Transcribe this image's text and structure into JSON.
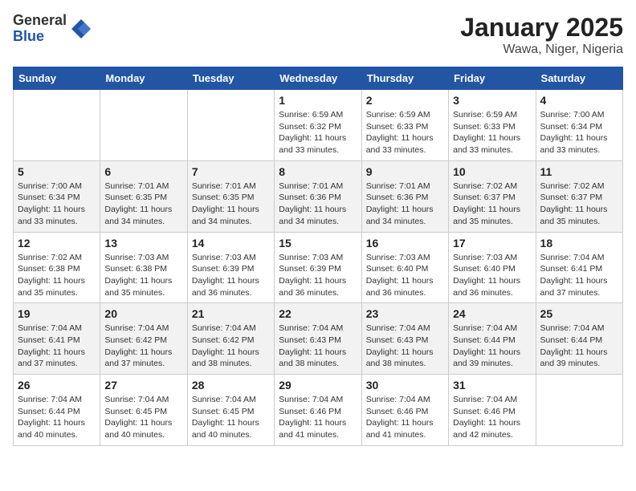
{
  "logo": {
    "general": "General",
    "blue": "Blue"
  },
  "header": {
    "month": "January 2025",
    "location": "Wawa, Niger, Nigeria"
  },
  "weekdays": [
    "Sunday",
    "Monday",
    "Tuesday",
    "Wednesday",
    "Thursday",
    "Friday",
    "Saturday"
  ],
  "weeks": [
    [
      {
        "day": "",
        "info": ""
      },
      {
        "day": "",
        "info": ""
      },
      {
        "day": "",
        "info": ""
      },
      {
        "day": "1",
        "info": "Sunrise: 6:59 AM\nSunset: 6:32 PM\nDaylight: 11 hours\nand 33 minutes."
      },
      {
        "day": "2",
        "info": "Sunrise: 6:59 AM\nSunset: 6:33 PM\nDaylight: 11 hours\nand 33 minutes."
      },
      {
        "day": "3",
        "info": "Sunrise: 6:59 AM\nSunset: 6:33 PM\nDaylight: 11 hours\nand 33 minutes."
      },
      {
        "day": "4",
        "info": "Sunrise: 7:00 AM\nSunset: 6:34 PM\nDaylight: 11 hours\nand 33 minutes."
      }
    ],
    [
      {
        "day": "5",
        "info": "Sunrise: 7:00 AM\nSunset: 6:34 PM\nDaylight: 11 hours\nand 33 minutes."
      },
      {
        "day": "6",
        "info": "Sunrise: 7:01 AM\nSunset: 6:35 PM\nDaylight: 11 hours\nand 34 minutes."
      },
      {
        "day": "7",
        "info": "Sunrise: 7:01 AM\nSunset: 6:35 PM\nDaylight: 11 hours\nand 34 minutes."
      },
      {
        "day": "8",
        "info": "Sunrise: 7:01 AM\nSunset: 6:36 PM\nDaylight: 11 hours\nand 34 minutes."
      },
      {
        "day": "9",
        "info": "Sunrise: 7:01 AM\nSunset: 6:36 PM\nDaylight: 11 hours\nand 34 minutes."
      },
      {
        "day": "10",
        "info": "Sunrise: 7:02 AM\nSunset: 6:37 PM\nDaylight: 11 hours\nand 35 minutes."
      },
      {
        "day": "11",
        "info": "Sunrise: 7:02 AM\nSunset: 6:37 PM\nDaylight: 11 hours\nand 35 minutes."
      }
    ],
    [
      {
        "day": "12",
        "info": "Sunrise: 7:02 AM\nSunset: 6:38 PM\nDaylight: 11 hours\nand 35 minutes."
      },
      {
        "day": "13",
        "info": "Sunrise: 7:03 AM\nSunset: 6:38 PM\nDaylight: 11 hours\nand 35 minutes."
      },
      {
        "day": "14",
        "info": "Sunrise: 7:03 AM\nSunset: 6:39 PM\nDaylight: 11 hours\nand 36 minutes."
      },
      {
        "day": "15",
        "info": "Sunrise: 7:03 AM\nSunset: 6:39 PM\nDaylight: 11 hours\nand 36 minutes."
      },
      {
        "day": "16",
        "info": "Sunrise: 7:03 AM\nSunset: 6:40 PM\nDaylight: 11 hours\nand 36 minutes."
      },
      {
        "day": "17",
        "info": "Sunrise: 7:03 AM\nSunset: 6:40 PM\nDaylight: 11 hours\nand 36 minutes."
      },
      {
        "day": "18",
        "info": "Sunrise: 7:04 AM\nSunset: 6:41 PM\nDaylight: 11 hours\nand 37 minutes."
      }
    ],
    [
      {
        "day": "19",
        "info": "Sunrise: 7:04 AM\nSunset: 6:41 PM\nDaylight: 11 hours\nand 37 minutes."
      },
      {
        "day": "20",
        "info": "Sunrise: 7:04 AM\nSunset: 6:42 PM\nDaylight: 11 hours\nand 37 minutes."
      },
      {
        "day": "21",
        "info": "Sunrise: 7:04 AM\nSunset: 6:42 PM\nDaylight: 11 hours\nand 38 minutes."
      },
      {
        "day": "22",
        "info": "Sunrise: 7:04 AM\nSunset: 6:43 PM\nDaylight: 11 hours\nand 38 minutes."
      },
      {
        "day": "23",
        "info": "Sunrise: 7:04 AM\nSunset: 6:43 PM\nDaylight: 11 hours\nand 38 minutes."
      },
      {
        "day": "24",
        "info": "Sunrise: 7:04 AM\nSunset: 6:44 PM\nDaylight: 11 hours\nand 39 minutes."
      },
      {
        "day": "25",
        "info": "Sunrise: 7:04 AM\nSunset: 6:44 PM\nDaylight: 11 hours\nand 39 minutes."
      }
    ],
    [
      {
        "day": "26",
        "info": "Sunrise: 7:04 AM\nSunset: 6:44 PM\nDaylight: 11 hours\nand 40 minutes."
      },
      {
        "day": "27",
        "info": "Sunrise: 7:04 AM\nSunset: 6:45 PM\nDaylight: 11 hours\nand 40 minutes."
      },
      {
        "day": "28",
        "info": "Sunrise: 7:04 AM\nSunset: 6:45 PM\nDaylight: 11 hours\nand 40 minutes."
      },
      {
        "day": "29",
        "info": "Sunrise: 7:04 AM\nSunset: 6:46 PM\nDaylight: 11 hours\nand 41 minutes."
      },
      {
        "day": "30",
        "info": "Sunrise: 7:04 AM\nSunset: 6:46 PM\nDaylight: 11 hours\nand 41 minutes."
      },
      {
        "day": "31",
        "info": "Sunrise: 7:04 AM\nSunset: 6:46 PM\nDaylight: 11 hours\nand 42 minutes."
      },
      {
        "day": "",
        "info": ""
      }
    ]
  ]
}
